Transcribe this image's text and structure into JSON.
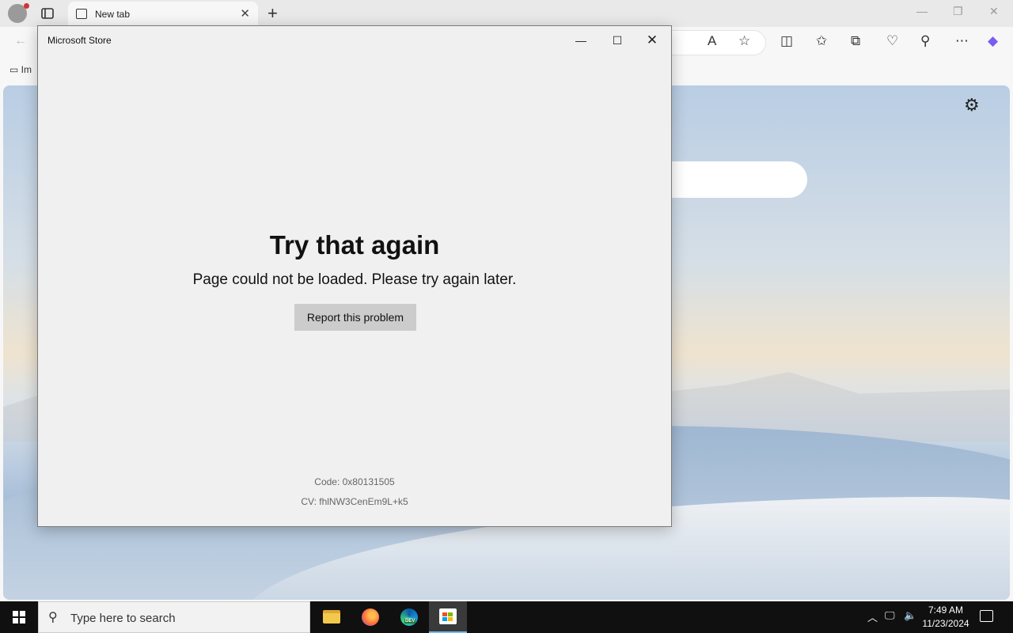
{
  "browser": {
    "tab_title": "New tab",
    "new_tab_symbol": "+",
    "favorites_item": "Im"
  },
  "store_window": {
    "title": "Microsoft Store",
    "error_title": "Try that again",
    "error_message": "Page could not be loaded. Please try again later.",
    "report_button": "Report this problem",
    "code": "Code: 0x80131505",
    "cv": "CV: fhlNW3CenEm9L+k5"
  },
  "taskbar": {
    "search_placeholder": "Type here to search",
    "time": "7:49 AM",
    "date": "11/23/2024",
    "apps": [
      "file-explorer",
      "firefox",
      "edge-dev",
      "microsoft-store"
    ]
  },
  "colors": {
    "taskbar": "#101010",
    "store_bg": "#f0f0f0",
    "report_button_bg": "#cccccc",
    "accent": "#76b9ed"
  }
}
